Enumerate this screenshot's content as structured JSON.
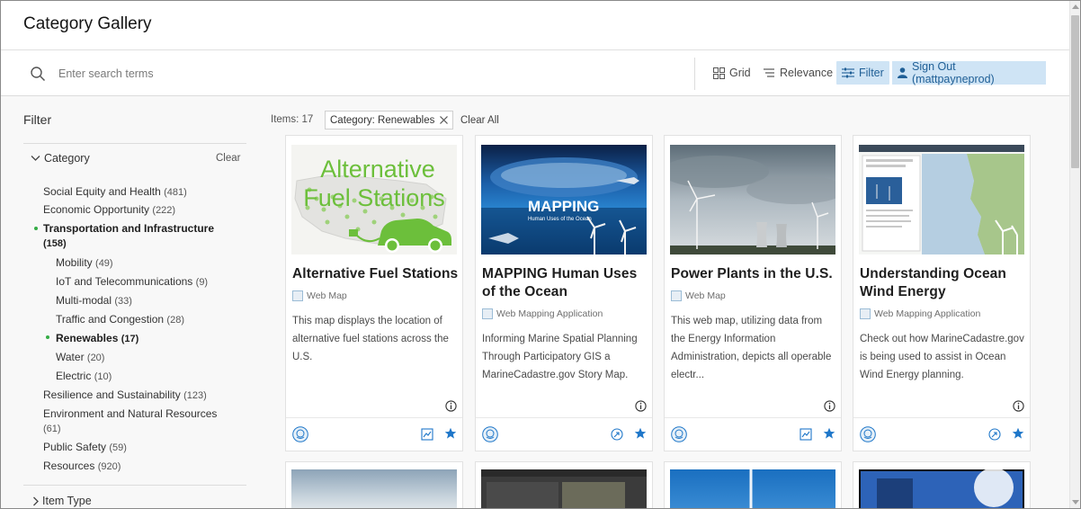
{
  "header": {
    "title": "Category Gallery"
  },
  "toolbar": {
    "search_placeholder": "Enter search terms",
    "grid_label": "Grid",
    "relevance_label": "Relevance",
    "filter_label": "Filter",
    "signout_label": "Sign Out (mattpayneprod)"
  },
  "sidebar": {
    "title": "Filter",
    "category_header": "Category",
    "clear_label": "Clear",
    "facets": [
      {
        "label": "Social Equity and Health",
        "count": "(481)"
      },
      {
        "label": "Economic Opportunity",
        "count": "(222)"
      },
      {
        "label": "Transportation and Infrastructure",
        "count": "(158)",
        "active": true
      },
      {
        "label": "Mobility",
        "count": "(49)"
      },
      {
        "label": "IoT and Telecommunications",
        "count": "(9)"
      },
      {
        "label": "Multi-modal",
        "count": "(33)"
      },
      {
        "label": "Traffic and Congestion",
        "count": "(28)"
      },
      {
        "label": "Renewables",
        "count": "(17)",
        "active": true
      },
      {
        "label": "Water",
        "count": "(20)"
      },
      {
        "label": "Electric",
        "count": "(10)"
      },
      {
        "label": "Resilience and Sustainability",
        "count": "(123)"
      },
      {
        "label": "Environment and Natural Resources",
        "count": "(61)"
      },
      {
        "label": "Public Safety",
        "count": "(59)"
      },
      {
        "label": "Resources",
        "count": "(920)"
      }
    ],
    "item_type_header": "Item Type"
  },
  "results": {
    "items_label": "Items: 17",
    "chip_label": "Category: Renewables",
    "clear_all_label": "Clear All"
  },
  "cards": [
    {
      "thumb_title_line1": "Alternative",
      "thumb_title_line2": "Fuel Stations",
      "title": "Alternative Fuel Stations",
      "type": "Web Map",
      "description": "This map displays the location of alternative fuel stations across the U.S."
    },
    {
      "thumb_title": "MAPPING",
      "thumb_subtitle": "Human Uses of the Ocean",
      "title": "MAPPING Human Uses of the Ocean",
      "type": "Web Mapping Application",
      "description": "Informing Marine Spatial Planning Through Participatory GIS a MarineCadastre.gov Story Map."
    },
    {
      "title": "Power Plants in the U.S.",
      "type": "Web Map",
      "description": "This web map, utilizing data from the Energy Information Administration, depicts all operable electr..."
    },
    {
      "title": "Understanding Ocean Wind Energy",
      "type": "Web Mapping Application",
      "description": "Check out how MarineCadastre.gov is being used to assist in Ocean Wind Energy planning."
    }
  ],
  "colors": {
    "accent": "#1f77c9",
    "accent_bg": "#cfe4f5",
    "facet_dot": "#35ac46"
  }
}
